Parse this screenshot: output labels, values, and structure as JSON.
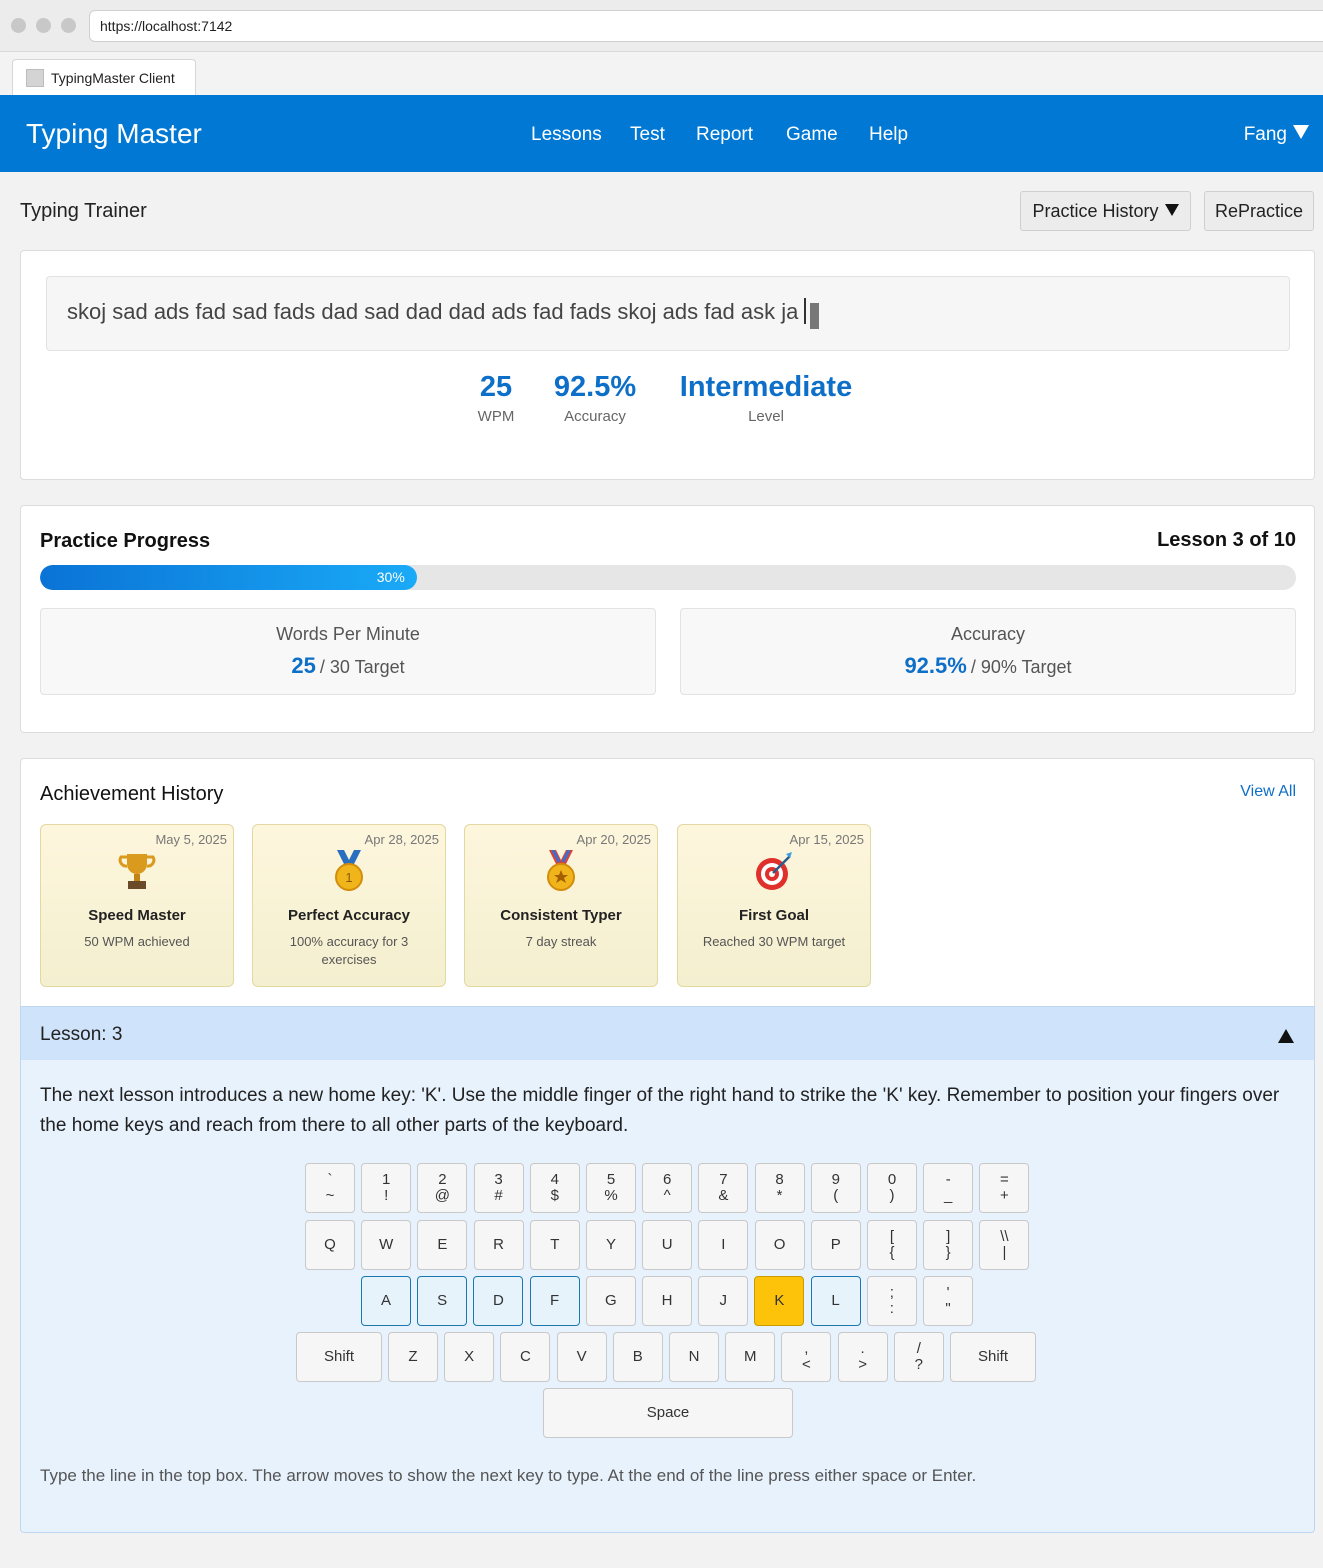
{
  "browser": {
    "url": "https://localhost:7142",
    "tab_title": "TypingMaster Client"
  },
  "navbar": {
    "brand": "Typing Master",
    "links": [
      "Lessons",
      "Test",
      "Report",
      "Game",
      "Help"
    ],
    "user": "Fang"
  },
  "header": {
    "title": "Typing Trainer",
    "history_button": "Practice History",
    "repractice_button": "RePractice"
  },
  "trainer": {
    "typed_text": "skoj sad ads fad sad fads dad sad dad dad ads fad fads skoj ads fad ask ja",
    "stats": [
      {
        "value": "25",
        "label": "WPM"
      },
      {
        "value": "92.5%",
        "label": "Accuracy"
      },
      {
        "value": "Intermediate",
        "label": "Level"
      }
    ]
  },
  "progress": {
    "title": "Practice Progress",
    "lesson_of": "Lesson 3 of 10",
    "percent": 30,
    "percent_label": "30%",
    "wpm": {
      "title": "Words Per Minute",
      "value": "25",
      "target": "/ 30 Target"
    },
    "accuracy": {
      "title": "Accuracy",
      "value": "92.5%",
      "target": "/ 90% Target"
    }
  },
  "achievements": {
    "title": "Achievement History",
    "view_all": "View All",
    "items": [
      {
        "date": "May 5, 2025",
        "name": "Speed Master",
        "desc": "50 WPM achieved",
        "icon": "trophy-icon"
      },
      {
        "date": "Apr 28, 2025",
        "name": "Perfect Accuracy",
        "desc": "100% accuracy for 3 exercises",
        "icon": "gold-medal-icon"
      },
      {
        "date": "Apr 20, 2025",
        "name": "Consistent Typer",
        "desc": "7 day streak",
        "icon": "star-medal-icon"
      },
      {
        "date": "Apr 15, 2025",
        "name": "First Goal",
        "desc": "Reached 30 WPM target",
        "icon": "target-icon"
      }
    ]
  },
  "lesson": {
    "header": "Lesson: 3",
    "description": "The next lesson introduces a new home key: 'K'. Use the middle finger of the right hand to strike the 'K' key. Remember to position your fingers over the home keys and reach from there to all other parts of the keyboard.",
    "hint": "Type the line in the top box. The arrow moves to show the next key to type. At the end of the line press either space or Enter."
  },
  "keyboard": {
    "rows": [
      [
        "`\n~",
        "1\n!",
        "2\n@",
        "3\n#",
        "4\n$",
        "5\n%",
        "6\n^",
        "7\n&",
        "8\n*",
        "9\n(",
        "0\n)",
        "-\n_",
        "=\n+"
      ],
      [
        "Q",
        "W",
        "E",
        "R",
        "T",
        "Y",
        "U",
        "I",
        "O",
        "P",
        "[\n{",
        "]\n}",
        "\\\\\n|"
      ],
      [
        "A",
        "S",
        "D",
        "F",
        "G",
        "H",
        "J",
        "K",
        "L",
        ";\n:",
        "'\n\""
      ],
      [
        "Shift",
        "Z",
        "X",
        "C",
        "V",
        "B",
        "N",
        "M",
        ",\n<",
        ".\n>",
        "/\n?",
        "Shift"
      ],
      [
        "Space"
      ]
    ],
    "home_keys": [
      "A",
      "S",
      "D",
      "F",
      "L"
    ],
    "active_key": "K",
    "active_color": "#fcc30a",
    "home_color": "#1a7ab0"
  },
  "colors": {
    "primary": "#0078d4",
    "accent": "#0e6fc8"
  }
}
